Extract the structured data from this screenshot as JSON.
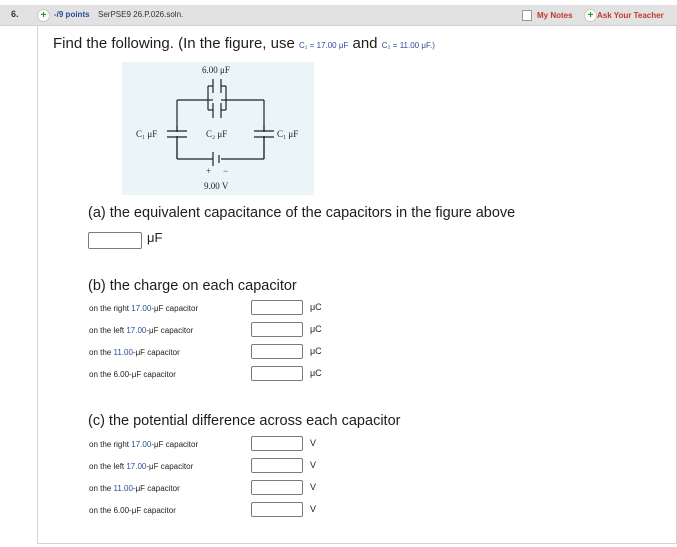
{
  "header": {
    "question_number": "6.",
    "points": "-/9 points",
    "source": "SerPSE9 26.P.026.soln.",
    "my_notes": "My Notes",
    "ask_teacher": "Ask Your Teacher"
  },
  "prompt": {
    "intro": "Find the following. (In the figure, use",
    "c1_label": "C₁ = ",
    "c1_value": "17.00",
    "c1_unit": " μF",
    "and": " and ",
    "c2_label": "C₂ = ",
    "c2_value": "11.00",
    "c2_unit": " μF.)"
  },
  "figure": {
    "top_cap": "6.00 μF",
    "left_cap": "C₁ μF",
    "middle_cap": "C₂ μF",
    "right_cap": "C₁ μF",
    "battery": "9.00 V",
    "plus": "+",
    "minus": "−"
  },
  "part_a": {
    "heading": "(a) the equivalent capacitance of the capacitors in the figure above",
    "unit": "μF"
  },
  "part_b": {
    "heading": "(b) the charge on each capacitor",
    "rows": [
      {
        "pre": "on the right ",
        "val": "17.00",
        "post": "-μF capacitor",
        "unit": "μC"
      },
      {
        "pre": "on the left ",
        "val": "17.00",
        "post": "-μF capacitor",
        "unit": "μC"
      },
      {
        "pre": "on the ",
        "val": "11.00",
        "post": "-μF capacitor",
        "unit": "μC"
      },
      {
        "pre": "on the 6.00",
        "val": "",
        "post": "-μF capacitor",
        "unit": "μC"
      }
    ]
  },
  "part_c": {
    "heading": "(c) the potential difference across each capacitor",
    "rows": [
      {
        "pre": "on the right ",
        "val": "17.00",
        "post": "-μF capacitor",
        "unit": "V"
      },
      {
        "pre": "on the left ",
        "val": "17.00",
        "post": "-μF capacitor",
        "unit": "V"
      },
      {
        "pre": "on the ",
        "val": "11.00",
        "post": "-μF capacitor",
        "unit": "V"
      },
      {
        "pre": "on the 6.00",
        "val": "",
        "post": "-μF capacitor",
        "unit": "V"
      }
    ]
  },
  "colors": {
    "highlight_blue": "#2b4d9c",
    "header_red": "#c0392b",
    "plus_green": "#2d8f2d",
    "figure_bg": "#eaf5f8"
  }
}
